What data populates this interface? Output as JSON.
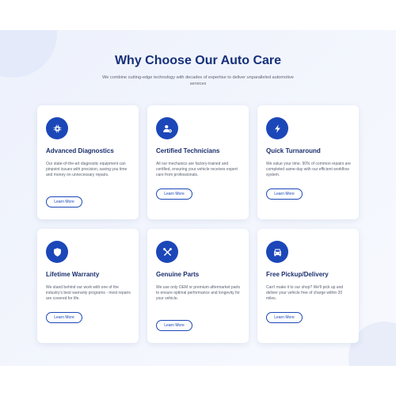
{
  "section": {
    "title": "Why Choose Our Auto Care",
    "subtitle": "We combine cutting-edge technology with decades of expertise to deliver unparalleled automotive services"
  },
  "cards": [
    {
      "title": "Advanced Diagnostics",
      "description": "Our state-of-the-art diagnostic equipment can pinpoint issues with precision, saving you time and money on unnecessary repairs.",
      "button": "Learn More",
      "icon": "microchip-icon"
    },
    {
      "title": "Certified Technicians",
      "description": "All our mechanics are factory-trained and certified, ensuring your vehicle receives expert care from professionals.",
      "button": "Learn More",
      "icon": "user-gear-icon"
    },
    {
      "title": "Quick Turnaround",
      "description": "We value your time. 90% of common repairs are completed same-day with our efficient workflow system.",
      "button": "Learn More",
      "icon": "lightning-bolt-icon"
    },
    {
      "title": "Lifetime Warranty",
      "description": "We stand behind our work with one of the industry's best warranty programs - most repairs are covered for life.",
      "button": "Learn More",
      "icon": "shield-icon"
    },
    {
      "title": "Genuine Parts",
      "description": "We use only OEM or premium aftermarket parts to ensure optimal performance and longevity for your vehicle.",
      "button": "Learn More",
      "icon": "tools-icon"
    },
    {
      "title": "Free Pickup/Delivery",
      "description": "Can't make it to our shop? We'll pick up and deliver your vehicle free of charge within 20 miles.",
      "button": "Learn More",
      "icon": "car-icon"
    }
  ],
  "colors": {
    "accent": "#1b47b8",
    "heading": "#16307a",
    "background": "#f0f4fc"
  }
}
